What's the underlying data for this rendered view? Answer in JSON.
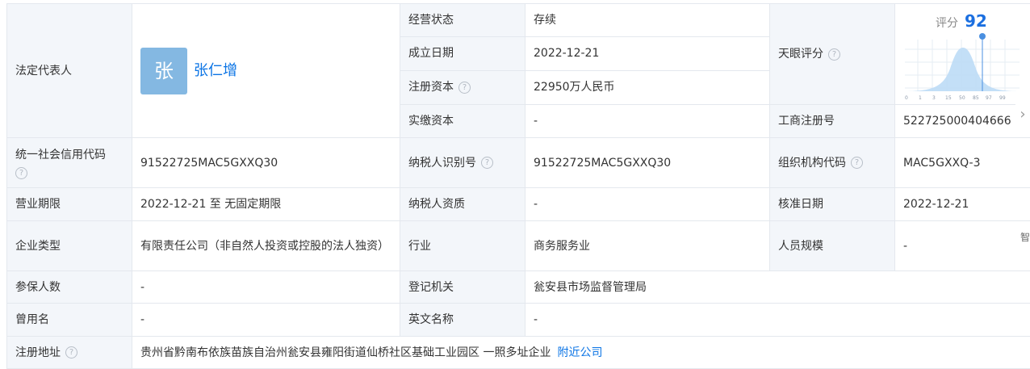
{
  "legal_rep": {
    "label": "法定代表人",
    "avatar_char": "张",
    "name": "张仁增"
  },
  "status": {
    "label": "经营状态",
    "value": "存续"
  },
  "established": {
    "label": "成立日期",
    "value": "2022-12-21"
  },
  "reg_capital": {
    "label": "注册资本",
    "value": "22950万人民币"
  },
  "paid_capital": {
    "label": "实缴资本",
    "value": "-"
  },
  "tianyan": {
    "label": "天眼评分",
    "score_label": "评分",
    "score": "92",
    "ticks": [
      "0",
      "1",
      "3",
      "15",
      "50",
      "85",
      "97",
      "99"
    ]
  },
  "biz_reg_no": {
    "label": "工商注册号",
    "value": "522725000404666"
  },
  "credit_code": {
    "label": "统一社会信用代码",
    "value": "91522725MAC5GXXQ30"
  },
  "taxpayer_id": {
    "label": "纳税人识别号",
    "value": "91522725MAC5GXXQ30"
  },
  "org_code": {
    "label": "组织机构代码",
    "value": "MAC5GXXQ-3"
  },
  "term": {
    "label": "营业期限",
    "value": "2022-12-21 至 无固定期限"
  },
  "taxpayer_qual": {
    "label": "纳税人资质",
    "value": "-"
  },
  "approve_date": {
    "label": "核准日期",
    "value": "2022-12-21"
  },
  "company_type": {
    "label": "企业类型",
    "value": "有限责任公司（非自然人投资或控股的法人独资）"
  },
  "industry": {
    "label": "行业",
    "value": "商务服务业"
  },
  "staff_size": {
    "label": "人员规模",
    "value": "-"
  },
  "insured": {
    "label": "参保人数",
    "value": "-"
  },
  "reg_authority": {
    "label": "登记机关",
    "value": "瓮安县市场监督管理局"
  },
  "former_name": {
    "label": "曾用名",
    "value": "-"
  },
  "english_name": {
    "label": "英文名称",
    "value": "-"
  },
  "reg_address": {
    "label": "注册地址",
    "value": "贵州省黔南布依族苗族自治州瓮安县雍阳街道仙桥社区基础工业园区 一照多址企业",
    "link": "附近公司"
  },
  "help_glyph": "?",
  "next_glyph": "›",
  "edge_char": "智",
  "colors": {
    "link": "#0b74e5",
    "label_bg": "#f3f6fa",
    "avatar": "#84b8e2",
    "score": "#1b6fe0"
  }
}
